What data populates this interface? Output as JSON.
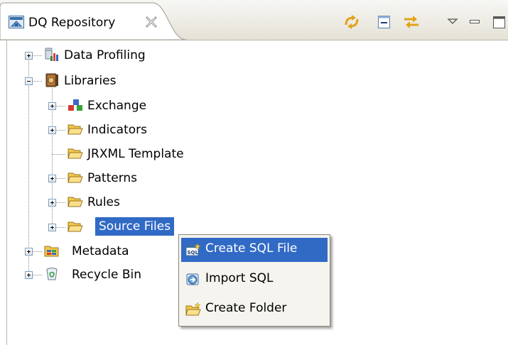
{
  "view": {
    "title": "DQ Repository",
    "icon": "repository-icon",
    "toolbar": [
      "sync-icon",
      "collapse-all-icon",
      "link-with-editor-icon",
      "view-menu-icon",
      "minimize-icon",
      "maximize-icon"
    ]
  },
  "tree": {
    "data_profiling": {
      "label": "Data Profiling",
      "icon": "data-profiling-icon",
      "expanded": false
    },
    "libraries": {
      "label": "Libraries",
      "icon": "libraries-icon",
      "expanded": true
    },
    "exchange": {
      "label": "Exchange",
      "icon": "exchange-icon",
      "expanded": false
    },
    "indicators": {
      "label": "Indicators",
      "icon": "folder-icon",
      "expanded": false
    },
    "jrxml_template": {
      "label": "JRXML Template",
      "icon": "folder-icon"
    },
    "patterns": {
      "label": "Patterns",
      "icon": "folder-icon",
      "expanded": false
    },
    "rules": {
      "label": "Rules",
      "icon": "folder-icon",
      "expanded": false
    },
    "source_files": {
      "label": "Source Files",
      "icon": "folder-icon",
      "expanded": false,
      "selected": true
    },
    "metadata": {
      "label": "Metadata",
      "icon": "metadata-icon",
      "expanded": false
    },
    "recycle_bin": {
      "label": "Recycle Bin",
      "icon": "recycle-bin-icon",
      "expanded": false
    }
  },
  "context_menu": {
    "items": [
      {
        "label": "Create SQL File",
        "icon": "sql-file-icon",
        "highlighted": true
      },
      {
        "label": "Import SQL",
        "icon": "import-sql-icon"
      },
      {
        "label": "Create Folder",
        "icon": "new-folder-icon"
      }
    ]
  },
  "colors": {
    "selection": "#316ac5",
    "menu_background": "#f5f4ee",
    "folder": "#f2c94c"
  }
}
